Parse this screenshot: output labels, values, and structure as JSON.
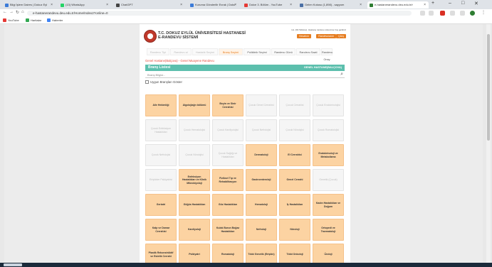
{
  "browser": {
    "tabs": [
      {
        "label": "Bilgi İşlem Daires | Dokuz Eyl",
        "color": "#3b7bd8",
        "active": false
      },
      {
        "label": "(13) WhatsApp",
        "color": "#25d366",
        "active": false
      },
      {
        "label": "ChatGPT",
        "color": "#444444",
        "active": false
      },
      {
        "label": "Kuruma Gönderilir Evrak | Doku",
        "color": "#3b7bd8",
        "active": false
      },
      {
        "label": "Dolce 3. Bölüm - YouTube",
        "color": "#e53935",
        "active": false
      },
      {
        "label": "Gelen Kutusu (1,898) - sayyum",
        "color": "#4a6fa5",
        "active": false
      },
      {
        "label": "e-hastanerandevu.deu.edu.tr/r",
        "color": "#2e7d32",
        "active": true
      }
    ],
    "url": "e-hastanerandevu.deu.edu.tr/Home/Index2?online=0",
    "bookmarks": [
      {
        "label": "YouTube",
        "color": "#e53935"
      },
      {
        "label": "Haritalar",
        "color": "#34a853"
      },
      {
        "label": "Haberler",
        "color": "#4285f4"
      }
    ]
  },
  "header": {
    "title_line1": "T.C. DOKUZ EYLÜL ÜNİVERSİTESİ HASTANESİ",
    "title_line2": "E-RANDEVU SİSTEMİ",
    "info": "Hs. (Dil Tablosu). Hastane randevu sistemine hoş geldiniz",
    "buttons": [
      "Hesabım",
      "Randevularım",
      "Çıkış"
    ]
  },
  "nav": [
    {
      "label": "Randevu Tipi",
      "state": "disabled"
    },
    {
      "label": "Randevu al",
      "state": "disabled"
    },
    {
      "label": "Hastalık Seçimi",
      "state": "disabled"
    },
    {
      "label": "Branş Seçimi",
      "state": "active"
    },
    {
      "label": "Poliklinik Seçimi",
      "state": "normal"
    },
    {
      "label": "Randevu Günü",
      "state": "normal"
    },
    {
      "label": "Randevu Saati",
      "state": "normal"
    },
    {
      "label": "Randevu Onay",
      "state": "normal"
    }
  ],
  "breadcrumb": "Genel Hastane(Balçova) - Genel Muayene Randevu",
  "section": {
    "title": "Branş Listesi",
    "right": "GENEL HASTANE(BALÇOVA)"
  },
  "search": {
    "placeholder": "Branş Bilgisi..."
  },
  "checkbox_label": "Uygun Branşları Göster",
  "branches": [
    {
      "label": "Aile Hekimliği",
      "enabled": true
    },
    {
      "label": "Algolojiağrı bölümü",
      "enabled": true
    },
    {
      "label": "Beyin ve Sinir Cerrahisi",
      "enabled": true
    },
    {
      "label": "Çocuk Genel Cerrahisi",
      "enabled": false
    },
    {
      "label": "Çocuk Cerrahisi",
      "enabled": false
    },
    {
      "label": "Çocuk Endokrinolojisi",
      "enabled": false
    },
    {
      "label": "Çocuk Enfeksiyon Hastalıkları",
      "enabled": false
    },
    {
      "label": "Çocuk Hematolojisi",
      "enabled": false
    },
    {
      "label": "Çocuk Kardiyolojisi",
      "enabled": false
    },
    {
      "label": "Çocuk Nefrolojisi",
      "enabled": false
    },
    {
      "label": "Çocuk Nörolojisi",
      "enabled": false
    },
    {
      "label": "Çocuk Romatolojisi",
      "enabled": false
    },
    {
      "label": "Çocuk Nefrolojisi",
      "enabled": false
    },
    {
      "label": "Çocuk Nörolojisi",
      "enabled": false
    },
    {
      "label": "Çocuk Sağlığı ve Hastalıkları",
      "enabled": false
    },
    {
      "label": "Dermatoloji",
      "enabled": true
    },
    {
      "label": "El Cerrahisi",
      "enabled": true
    },
    {
      "label": "Endokrinoloji ve Metabolizma",
      "enabled": true
    },
    {
      "label": "Erişkinler Psikiyatrisi",
      "enabled": false
    },
    {
      "label": "Enfeksiyon Hastalıkları ve Klinik Mikrobiyoloji",
      "enabled": true
    },
    {
      "label": "Fiziksel Tıp ve Rehabilitasyon",
      "enabled": true
    },
    {
      "label": "Gastroenteroloji",
      "enabled": true
    },
    {
      "label": "Genel Cerrahi",
      "enabled": true
    },
    {
      "label": "Genetik (Çocuk)",
      "enabled": false
    },
    {
      "label": "Geriatri",
      "enabled": true
    },
    {
      "label": "Göğüs Hastalıkları",
      "enabled": true
    },
    {
      "label": "Göz Hastalıkları",
      "enabled": true
    },
    {
      "label": "Hematoloji",
      "enabled": true
    },
    {
      "label": "İç Hastalıkları",
      "enabled": true
    },
    {
      "label": "Kadın Hastalıkları ve Doğum",
      "enabled": true
    },
    {
      "label": "Kalp ve Damar Cerrahisi",
      "enabled": true
    },
    {
      "label": "Kardiyoloji",
      "enabled": true
    },
    {
      "label": "Kulak Burun Boğaz Hastalıkları",
      "enabled": true
    },
    {
      "label": "Nefroloji",
      "enabled": true
    },
    {
      "label": "Nöroloji",
      "enabled": true
    },
    {
      "label": "Ortopedi ve Travmatoloji",
      "enabled": true
    },
    {
      "label": "Plastik Rekonstrüktif ve Estetik Cerrahi",
      "enabled": true
    },
    {
      "label": "Psikiyatri",
      "enabled": true
    },
    {
      "label": "Romatoloji",
      "enabled": true
    },
    {
      "label": "Tıbbi Genetik (Erişkin)",
      "enabled": true
    },
    {
      "label": "Tıbbi Onkoloji",
      "enabled": true
    },
    {
      "label": "Üroloji",
      "enabled": true
    }
  ]
}
